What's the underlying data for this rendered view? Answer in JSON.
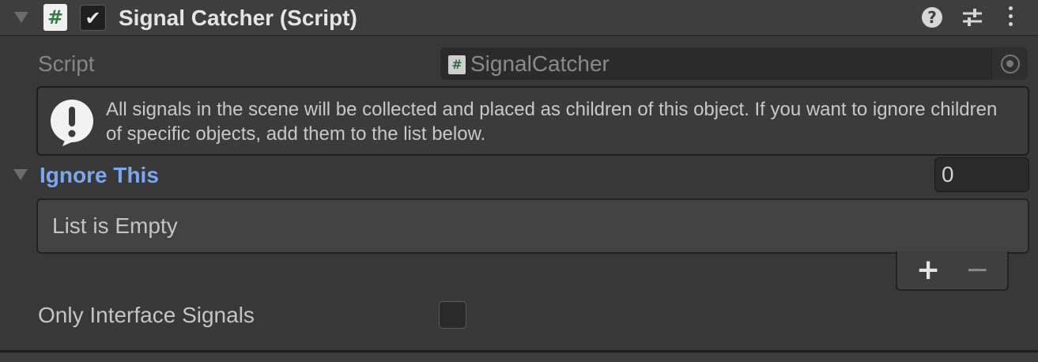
{
  "component": {
    "title": "Signal Catcher (Script)",
    "script_icon_glyph": "#",
    "enabled_glyph": "✔",
    "help_glyph": "?"
  },
  "script_row": {
    "label": "Script",
    "value": "SignalCatcher",
    "value_icon_glyph": "#"
  },
  "helpbox": {
    "text": "All signals in the scene will be collected and placed as children of this object. If you want to ignore children of specific objects, add them to the list below."
  },
  "ignore_list": {
    "label": "Ignore This",
    "count": "0",
    "empty_text": "List is Empty",
    "add_glyph": "+",
    "remove_glyph": "−"
  },
  "only_interface": {
    "label": "Only Interface Signals",
    "checked": false
  },
  "colors": {
    "background": "#383838",
    "header": "#3e3e3e",
    "accent_label": "#7ba7f0",
    "script_icon_green": "#2f7d44"
  }
}
